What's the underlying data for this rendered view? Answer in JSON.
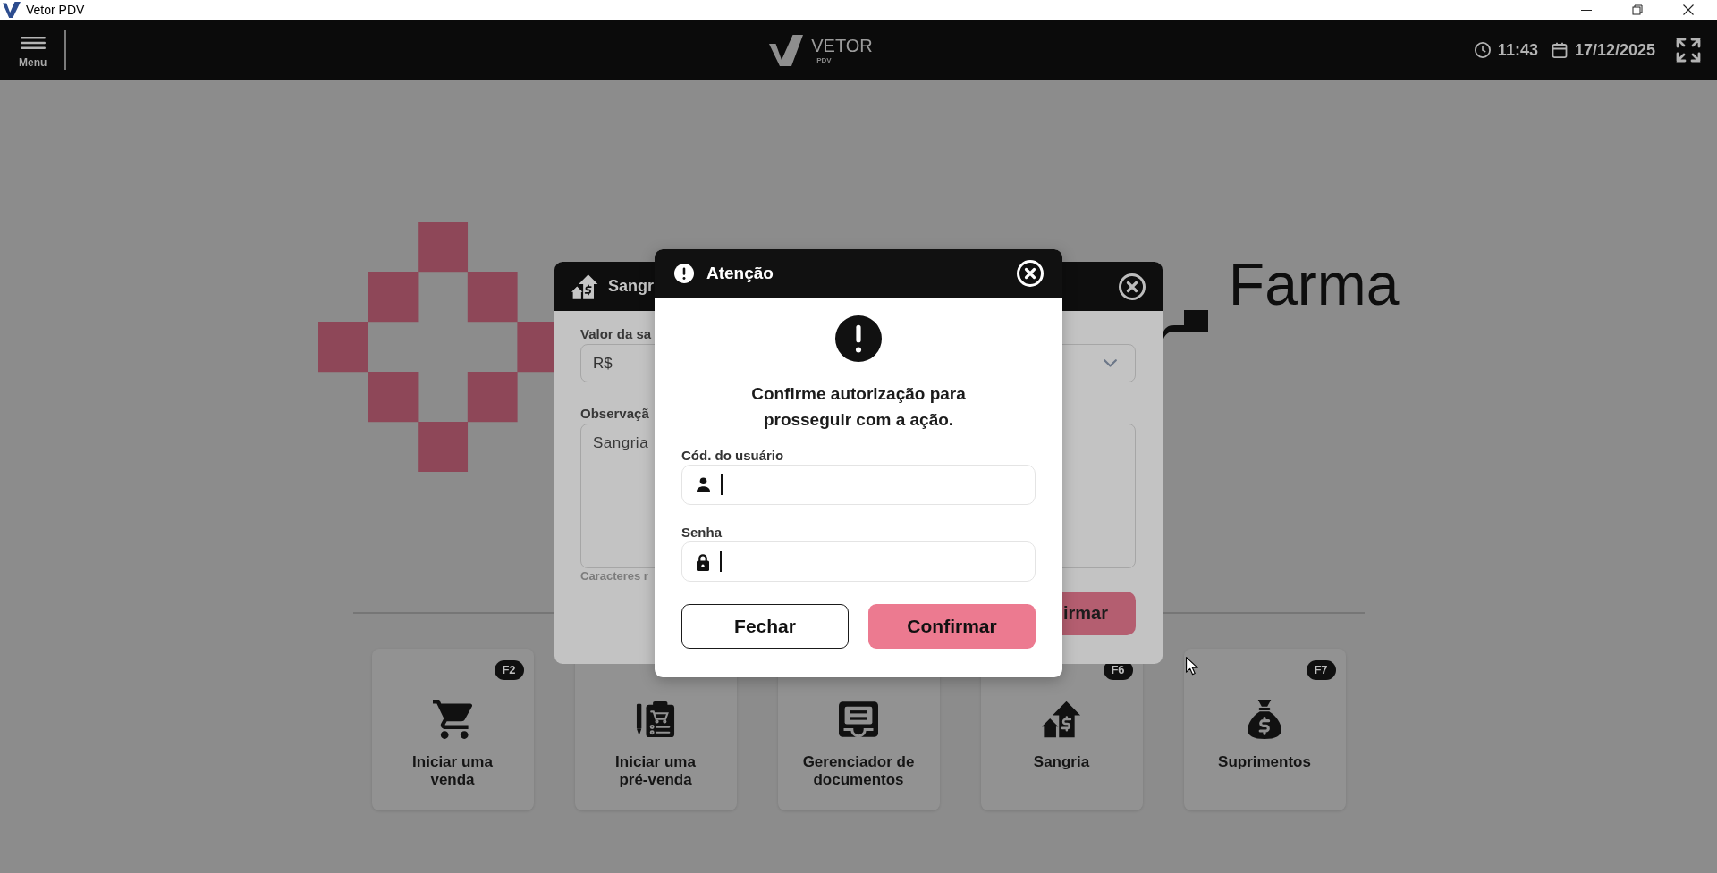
{
  "window": {
    "title": "Vetor PDV"
  },
  "header": {
    "menu_label": "Menu",
    "brand": "VETOR",
    "brand_sub": "PDV",
    "time": "11:43",
    "date": "17/12/2025"
  },
  "home": {
    "brand_word": "Farma",
    "actions": [
      {
        "label": "Iniciar uma venda",
        "shortcut": "F2",
        "kind": "cart"
      },
      {
        "label": "Iniciar uma pré-venda",
        "kind": "pre-sale"
      },
      {
        "label": "Gerenciador de documentos",
        "kind": "documents"
      },
      {
        "label": "Sangria",
        "shortcut": "F6",
        "kind": "withdrawal"
      },
      {
        "label": "Suprimentos",
        "shortcut": "F7",
        "kind": "supply"
      }
    ]
  },
  "background_dialog": {
    "title": "Sangr",
    "amount_label": "Valor da sa",
    "currency": "R$",
    "notes_label": "Observaçã",
    "notes_value": "Sangria",
    "counter": "Caracteres r",
    "confirm": "irmar"
  },
  "modal": {
    "title": "Atenção",
    "message": "Confirme autorização para prosseguir com a ação.",
    "fields": [
      {
        "label": "Cód. do usuário",
        "kind": "user",
        "focused": true
      },
      {
        "label": "Senha",
        "kind": "password",
        "focused": true
      }
    ],
    "buttons": [
      {
        "label": "Fechar",
        "kind": "secondary"
      },
      {
        "label": "Confirmar",
        "kind": "primary"
      }
    ]
  }
}
